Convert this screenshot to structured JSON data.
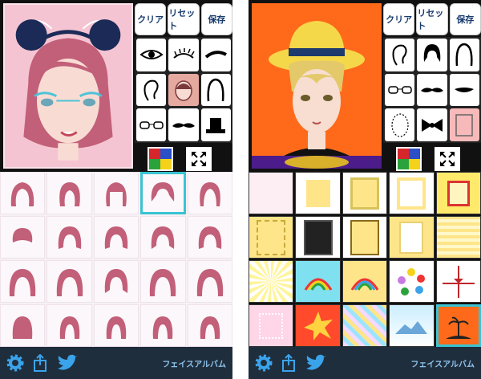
{
  "buttons": {
    "clear": "クリア",
    "reset": "リセット",
    "save": "保存"
  },
  "footer": {
    "app_label": "フェイスアルバム"
  },
  "left_parts": [
    "eye-icon",
    "eyelash-icon",
    "eyebrow-icon",
    "ear-icon",
    "face-shape-icon",
    "hair-outline-icon",
    "glasses-icon",
    "mustache-icon",
    "hat-icon"
  ],
  "right_parts": [
    "ear-icon",
    "hair-outline-icon",
    "hair-outline-icon",
    "glasses-icon",
    "mustache-icon",
    "mouth-icon",
    "face-outline-icon",
    "bow-icon",
    "frame-icon"
  ],
  "colors": {
    "accent": "#39c3d3",
    "bar": "#1f2e3d",
    "label": "#8fc4ec",
    "left_bg": "#f5c4d2",
    "right_bg": "#ff6a1a",
    "hair": "#c25f79"
  },
  "palette": [
    "#d6262c",
    "#2a4fc7",
    "#2ba33c",
    "#f5d21a"
  ],
  "backgrounds": [
    {
      "bg": "#fdeef4",
      "inner": "#fdeef4"
    },
    {
      "bg": "#fff",
      "inner": "#ffe58a"
    },
    {
      "bg": "#fff",
      "inner": "#ffe58a"
    },
    {
      "bg": "#fff",
      "inner": "#ffffff"
    },
    {
      "bg": "#ffea6b",
      "inner": "#d33"
    },
    {
      "bg": "#ffe58a",
      "inner": "#ffe58a"
    },
    {
      "bg": "#222",
      "inner": "#222"
    },
    {
      "bg": "#ffe58a",
      "inner": "#ffe58a"
    },
    {
      "bg": "#ffe58a",
      "inner": "#ffffff"
    },
    {
      "bg": "#ffe58a",
      "inner": "#fff8c9"
    },
    {
      "bg": "#fff49a",
      "inner": "#fff49a"
    },
    {
      "bg": "#7fe0f0",
      "inner": "#7fe0f0"
    },
    {
      "bg": "#ffe58a",
      "inner": "#ffe58a"
    },
    {
      "bg": "#fff",
      "inner": "#fff"
    },
    {
      "bg": "#fff",
      "inner": "#fff"
    },
    {
      "bg": "#ffd6e8",
      "inner": "#ffd6e8"
    },
    {
      "bg": "#ff4b2b",
      "inner": "#ffd23f"
    },
    {
      "bg": "#f4d9ff",
      "inner": "#9ee4ff"
    },
    {
      "bg": "#cbeeff",
      "inner": "#fff"
    },
    {
      "bg": "#ff6a1a",
      "inner": "#222"
    }
  ]
}
